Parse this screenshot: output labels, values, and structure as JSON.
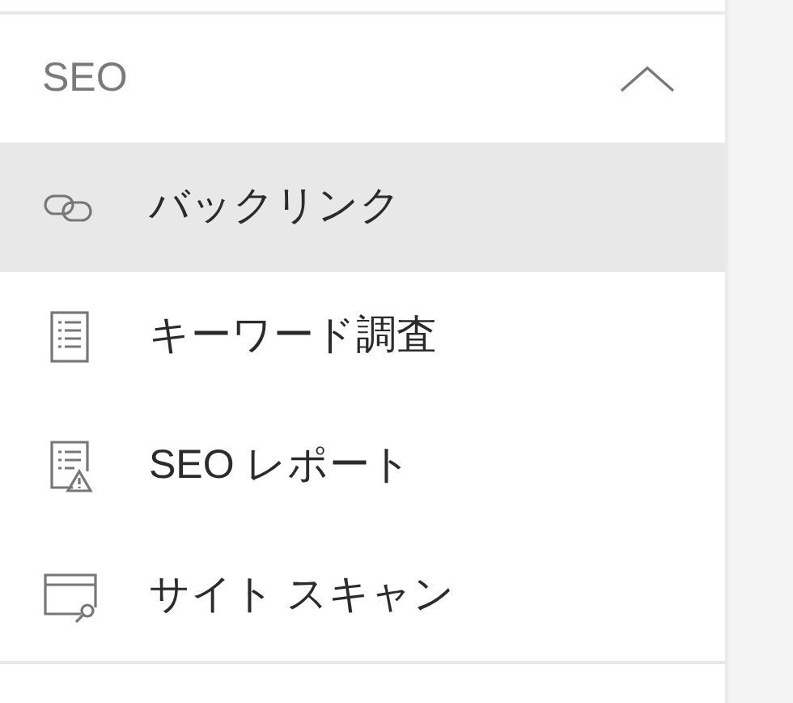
{
  "section": {
    "title": "SEO",
    "expanded": true
  },
  "items": [
    {
      "label": "バックリンク",
      "kind": "link",
      "selected": true
    },
    {
      "label": "キーワード調査",
      "kind": "document",
      "selected": false
    },
    {
      "label": "SEO レポート",
      "kind": "report",
      "selected": false
    },
    {
      "label": "サイト スキャン",
      "kind": "scan",
      "selected": false
    }
  ]
}
